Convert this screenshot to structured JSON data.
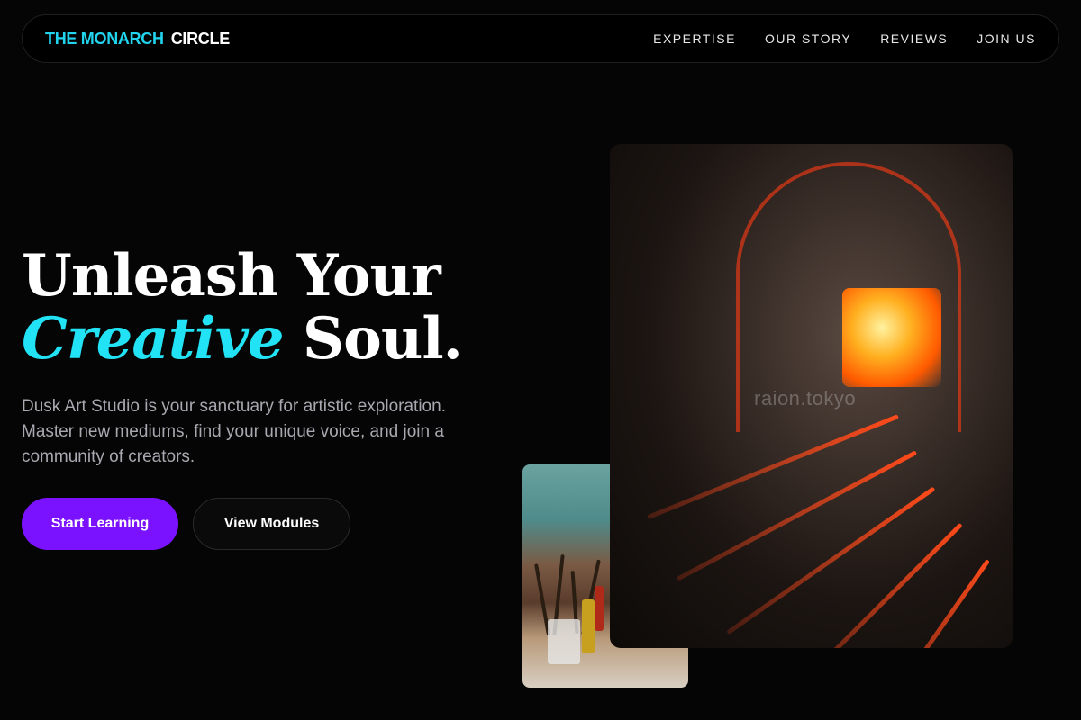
{
  "nav": {
    "logo_accent": "THE MONARCH",
    "logo_rest": "CIRCLE",
    "links": [
      "EXPERTISE",
      "OUR STORY",
      "REVIEWS",
      "JOIN US"
    ]
  },
  "hero": {
    "title_line1": "Unleash Your",
    "title_em": "Creative",
    "title_rest": "Soul.",
    "description": "Dusk Art Studio is your sanctuary for artistic exploration. Master new mediums, find your unique voice, and join a community of creators.",
    "primary_button": "Start Learning",
    "secondary_button": "View Modules"
  },
  "images": {
    "large_watermark": "raion.tokyo"
  },
  "colors": {
    "accent_cyan": "#22d3ee",
    "primary_purple": "#7b12ff",
    "background": "#050505"
  }
}
